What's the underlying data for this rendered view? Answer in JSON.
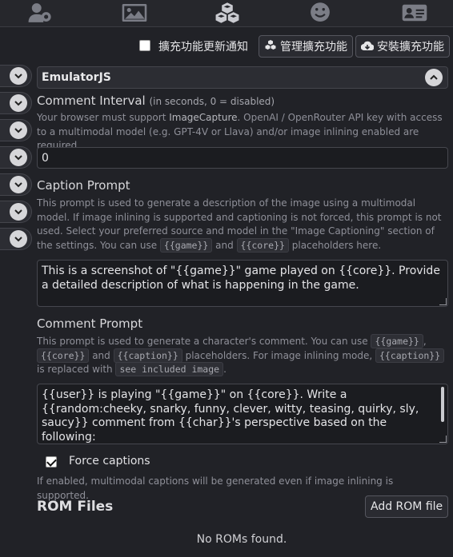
{
  "topbar": {
    "icons": [
      "user-settings-icon",
      "image-icon",
      "cubes-icon",
      "smile-icon",
      "id-card-icon"
    ]
  },
  "toolbar": {
    "notify_label": "擴充功能更新通知",
    "notify_checked": false,
    "manage_label": "管理擴充功能",
    "install_label": "安裝擴充功能"
  },
  "extension": {
    "title": "EmulatorJS"
  },
  "comment_interval": {
    "label": "Comment Interval",
    "hint": "(in seconds, 0 = disabled)",
    "desc_pre": "Your browser must support ",
    "desc_link": "ImageCapture",
    "desc_post": ". OpenAI / OpenRouter API key with access to a multimodal model (e.g. GPT-4V or Llava) and/or image inlining enabled are required.",
    "value": "0"
  },
  "caption_prompt": {
    "label": "Caption Prompt",
    "desc_pre": "This prompt is used to generate a description of the image using a multimodal model. If image inlining is supported and captioning is not forced, this prompt is not used. Select your preferred source and model in the \"Image Captioning\" section of the settings. You can use ",
    "code1": "{{game}}",
    "mid": " and ",
    "code2": "{{core}}",
    "desc_post": " placeholders here.",
    "value": "This is a screenshot of \"{{game}}\" game played on {{core}}. Provide a detailed description of what is happening in the game."
  },
  "comment_prompt": {
    "label": "Comment Prompt",
    "desc1": "This prompt is used to generate a character's comment. You can use ",
    "code_game": "{{game}}",
    "comma": ",",
    "code_core": "{{core}}",
    "and": " and ",
    "code_caption": "{{caption}}",
    "desc2": " placeholders. For image inlining mode, ",
    "code_caption2": "{{caption}}",
    "desc3": "is replaced with ",
    "code_see": "see included image",
    "period": ".",
    "value": "{{user}} is playing \"{{game}}\" on {{core}}. Write a {{random:cheeky, snarky, funny, clever, witty, teasing, quirky, sly, saucy}} comment from {{char}}'s perspective based on the following:"
  },
  "force_captions": {
    "label": "Force captions",
    "checked": true,
    "desc": "If enabled, multimodal captions will be generated even if image inlining is supported."
  },
  "rom_files": {
    "title": "ROM Files",
    "add_label": "Add ROM file",
    "empty": "No ROMs found."
  }
}
